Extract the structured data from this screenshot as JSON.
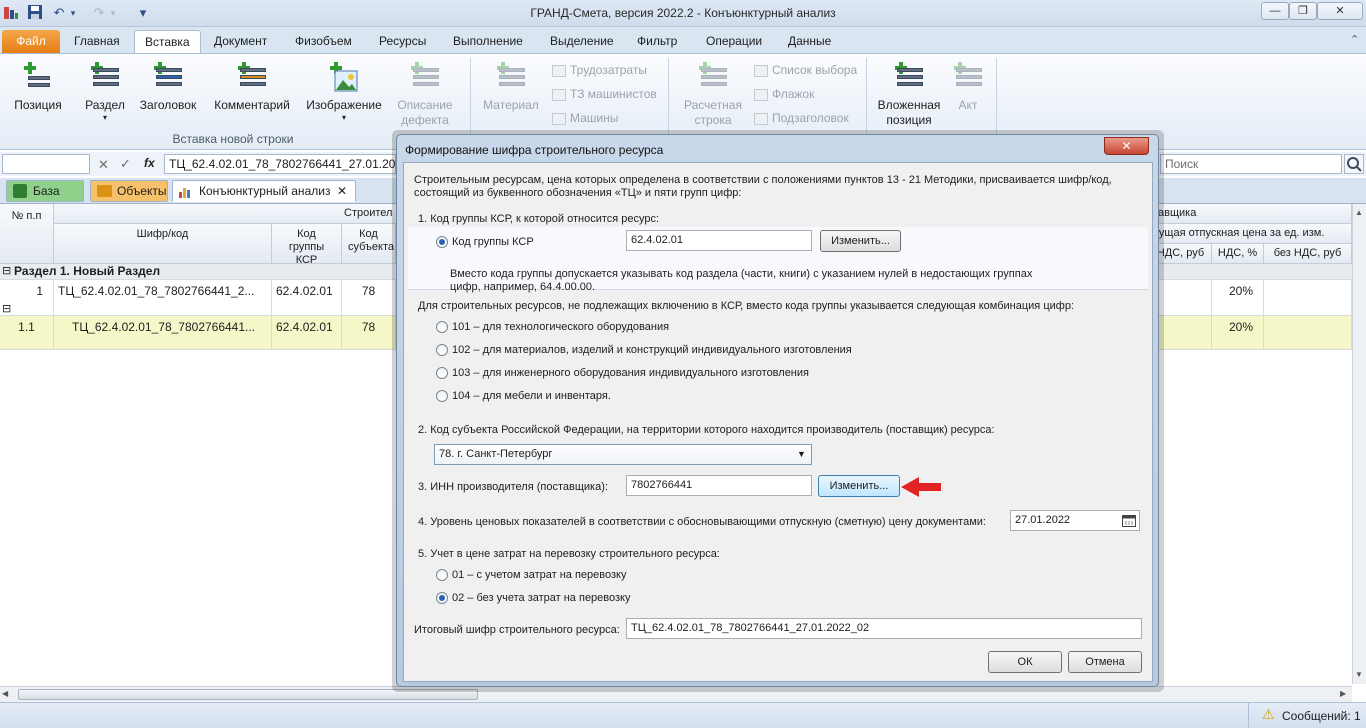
{
  "window": {
    "title": "ГРАНД-Смета, версия 2022.2 - Конъюнктурный анализ",
    "controls": {
      "minimize": "—",
      "restore": "❐",
      "close": "✕"
    }
  },
  "quick_access": {
    "undo": "↶",
    "redo": "↷",
    "dropdown": "▾"
  },
  "ribbon_tabs": [
    "Файл",
    "Главная",
    "Вставка",
    "Документ",
    "Физобъем",
    "Ресурсы",
    "Выполнение",
    "Выделение",
    "Фильтр",
    "Операции",
    "Данные"
  ],
  "ribbon": {
    "insert": {
      "position": "Позиция",
      "section": "Раздел",
      "header": "Заголовок",
      "comment": "Комментарий",
      "image": "Изображение",
      "defect_desc": "Описание дефекта",
      "group_label": "Вставка новой строки"
    },
    "resources": {
      "material": "Материал",
      "labor": "Трудозатраты",
      "machinists": "ТЗ машинистов",
      "machines": "Машины"
    },
    "other": {
      "calc_row": "Расчетная строка",
      "choice_list": "Список выбора",
      "flag": "Флажок",
      "subheader": "Подзаголовок",
      "nested": "Вложенная позиция",
      "act": "Акт"
    },
    "collapse": "⌃"
  },
  "formula_bar": {
    "cancel": "✕",
    "confirm": "✓",
    "fx": "fx",
    "value": "ТЦ_62.4.02.01_78_7802766441_27.01.2022_",
    "search_placeholder": "Поиск"
  },
  "doc_tabs": [
    {
      "label": "База"
    },
    {
      "label": "Объекты"
    },
    {
      "label": "Конъюнктурный анализ",
      "close": "✕"
    }
  ],
  "grid": {
    "headers": {
      "num": "№ п.п",
      "construction_group": "Строител",
      "code": "Шифр/код",
      "ksr": "Код группы КСР",
      "subject": "Код субъекта",
      "supplier_group": "авщика",
      "price_group": "кущая отпускная цена за ед. изм.",
      "nds_rub": "НДС, руб",
      "nds_pct": "НДС, %",
      "no_nds": "без НДС, руб"
    },
    "section": {
      "toggle": "⊟",
      "label": "Раздел 1. Новый Раздел"
    },
    "rows": [
      {
        "num": "1",
        "code": "ТЦ_62.4.02.01_78_7802766441_2...",
        "ksr": "62.4.02.01",
        "subject": "78",
        "nds": "20%"
      },
      {
        "num": "1.1",
        "code": "ТЦ_62.4.02.01_78_7802766441...",
        "ksr": "62.4.02.01",
        "subject": "78",
        "nds": "20%"
      }
    ],
    "group_toggle": "⊟"
  },
  "status": {
    "messages": "Сообщений: 1",
    "warning": "⚠"
  },
  "dialog": {
    "title": "Формирование шифра строительного ресурса",
    "close": "✕",
    "intro": [
      "Строительным ресурсам, цена которых определена в соответствии с положениями пунктов 13 - 21 Методики, присваивается шифр/код,",
      "состоящий из буквенного обозначения «ТЦ» и пяти групп цифр:"
    ],
    "s1_label": "1. Код группы КСР, к которой относится ресурс:",
    "s1_radio_label": "Код группы КСР",
    "s1_value": "62.4.02.01",
    "change_button": "Изменить...",
    "s1_hint": [
      "Вместо кода группы допускается указывать код раздела (части, книги) с указанием нулей в недостающих группах",
      "цифр, например, 64.4.00.00."
    ],
    "s1_alt_label": "Для строительных ресурсов, не подлежащих включению в КСР, вместо кода группы указывается следующая комбинация цифр:",
    "s1_options": [
      "101 – для технологического оборудования",
      "102 – для материалов, изделий и конструкций индивидуального изготовления",
      "103 – для инженерного оборудования индивидуального изготовления",
      "104 – для мебели и инвентаря."
    ],
    "s2_label": "2. Код субъекта Российской Федерации, на территории которого находится производитель (поставщик)  ресурса:",
    "s2_value": "78. г. Санкт-Петербург",
    "s3_label": "3. ИНН производителя (поставщика):",
    "s3_value": "7802766441",
    "s4_label": "4. Уровень ценовых показателей в соответствии с обосновывающими отпускную (сметную) цену документами:",
    "s4_value": "27.01.2022",
    "s5_label": "5. Учет в цене затрат на перевозку строительного ресурса:",
    "s5_options": [
      "01 – с учетом затрат на перевозку",
      "02 – без учета затрат на перевозку"
    ],
    "result_label": "Итоговый шифр строительного ресурса:",
    "result_value": "ТЦ_62.4.02.01_78_7802766441_27.01.2022_02",
    "ok": "ОК",
    "cancel": "Отмена"
  },
  "colors": {
    "highlight_row": "#f5f7c8",
    "accent": "#e23b2e",
    "file_tab": "#e67e14"
  }
}
